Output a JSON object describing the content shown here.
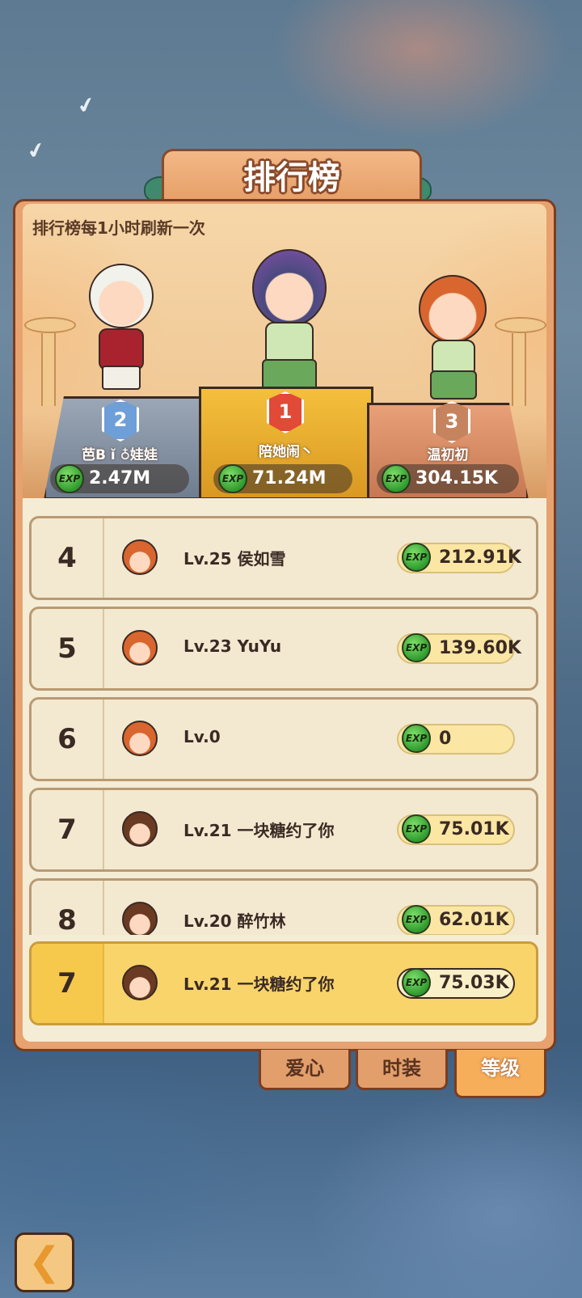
{
  "title": "排行榜",
  "refresh_note": "排行榜每1小时刷新一次",
  "exp_label": "EXP",
  "podium": [
    {
      "rank": "2",
      "name": "芭B ǐ ♁娃娃",
      "exp": "2.47M"
    },
    {
      "rank": "1",
      "name": "陪她闹丶",
      "exp": "71.24M"
    },
    {
      "rank": "3",
      "name": "温初初",
      "exp": "304.15K"
    }
  ],
  "rows": [
    {
      "rank": "4",
      "level_name": "Lv.25  侯如雪",
      "exp": "212.91K",
      "avatar": "girl"
    },
    {
      "rank": "5",
      "level_name": "Lv.23  YuYu",
      "exp": "139.60K",
      "avatar": "girl"
    },
    {
      "rank": "6",
      "level_name": "Lv.0",
      "exp": "0",
      "avatar": "girl"
    },
    {
      "rank": "7",
      "level_name": "Lv.21  一块糖约了你",
      "exp": "75.01K",
      "avatar": "boy"
    },
    {
      "rank": "8",
      "level_name": "Lv.20  醉竹林",
      "exp": "62.01K",
      "avatar": "boy"
    }
  ],
  "my_row": {
    "rank": "7",
    "level_name": "Lv.21  一块糖约了你",
    "exp": "75.03K",
    "avatar": "boy"
  },
  "tabs": [
    {
      "label": "爱心",
      "active": false
    },
    {
      "label": "时装",
      "active": false
    },
    {
      "label": "等级",
      "active": true
    }
  ],
  "back_icon": "back-arrow-icon",
  "colors": {
    "panel": "#e7a26f",
    "gold": "#f4c03c",
    "exp_green": "#2f9b2e"
  }
}
